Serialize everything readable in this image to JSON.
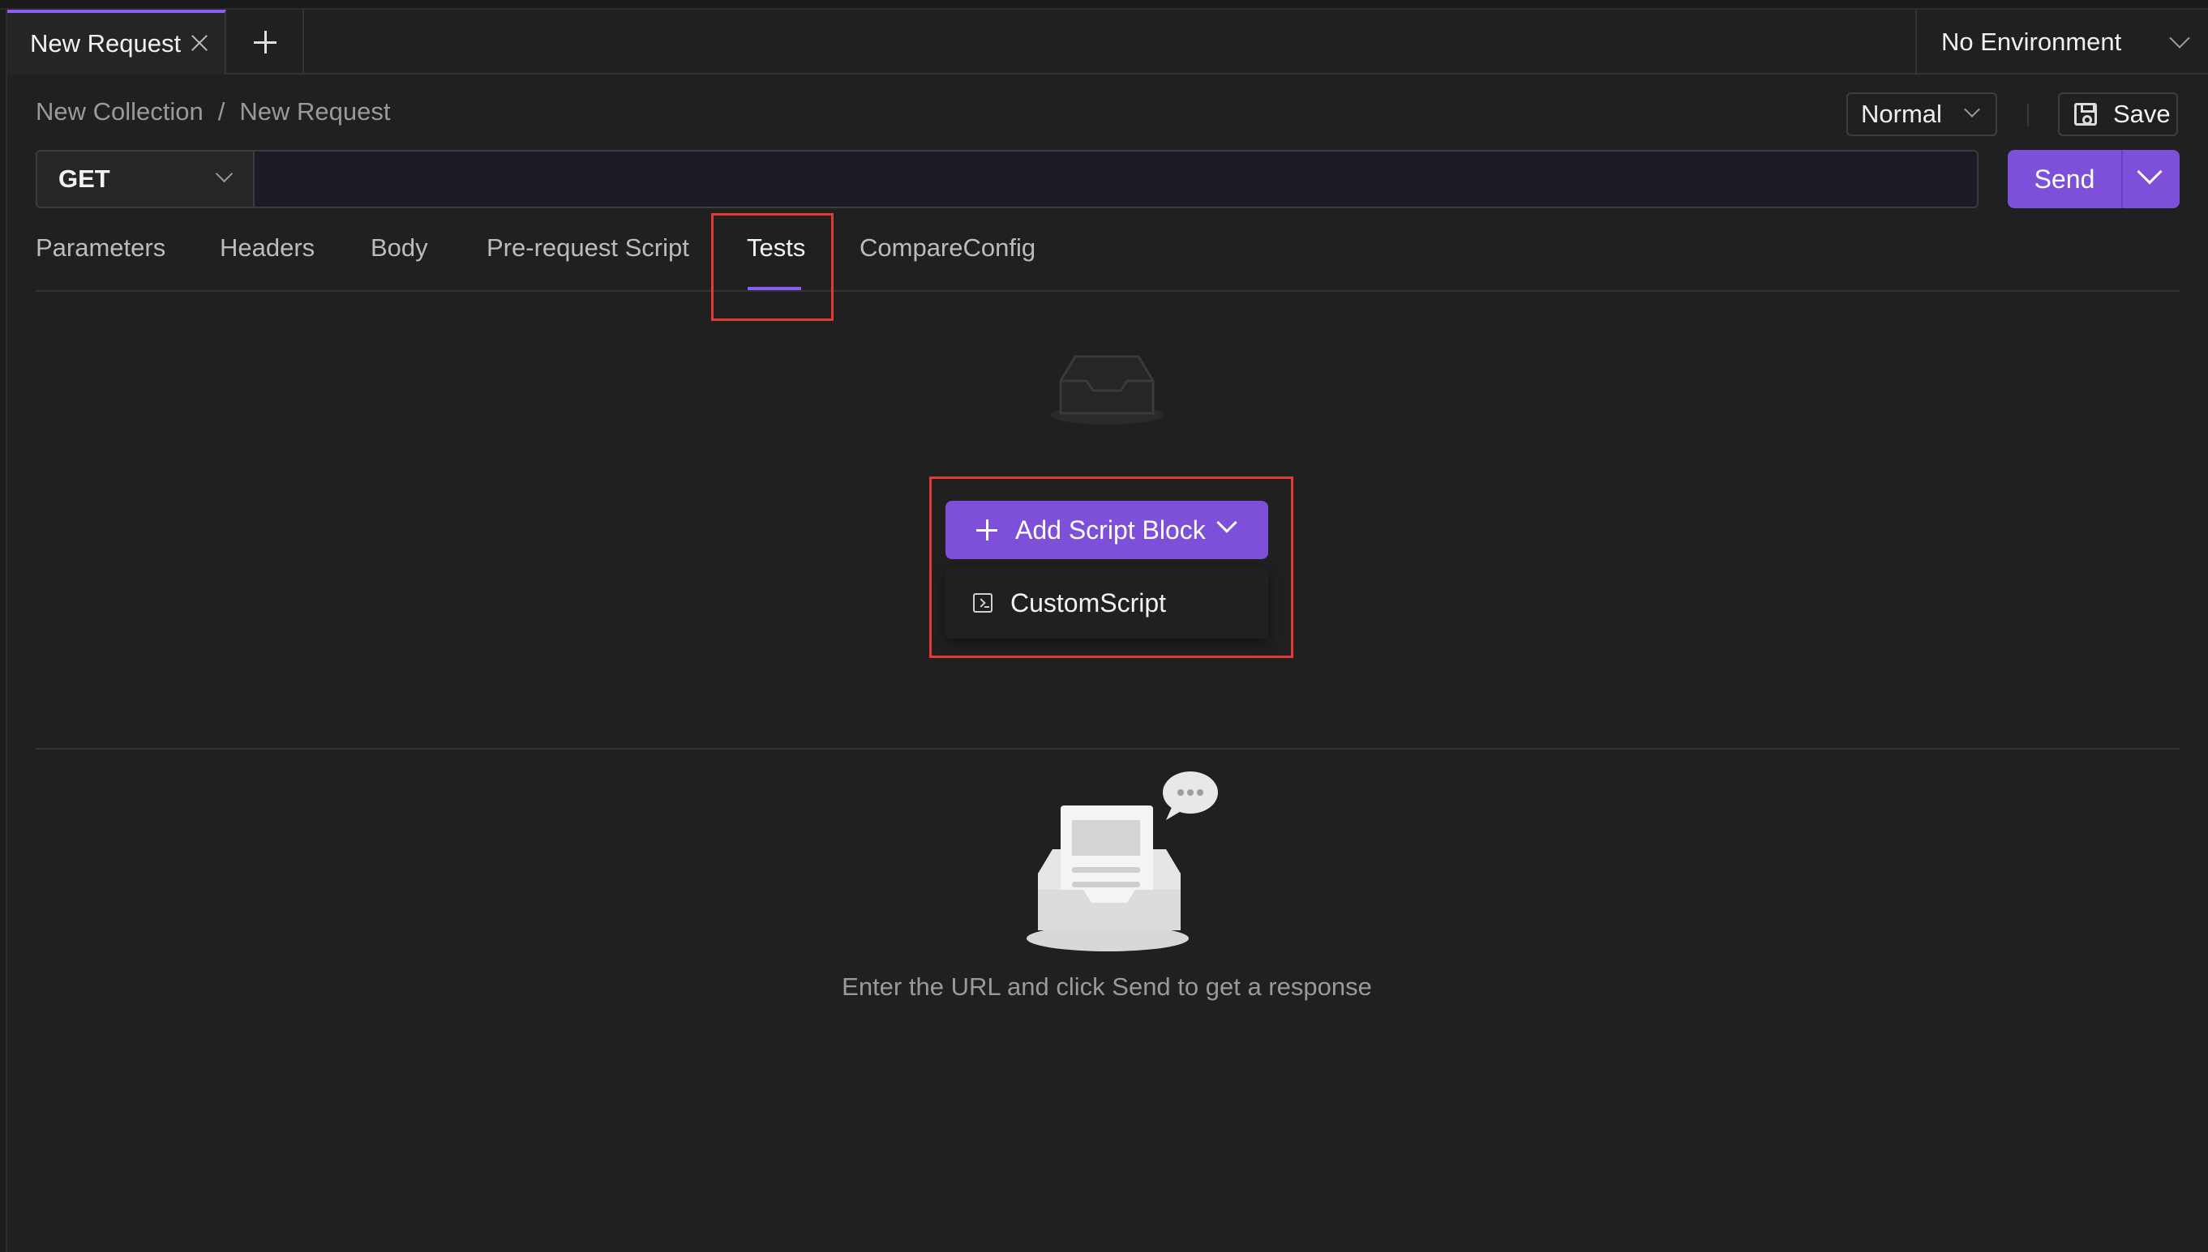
{
  "tabs": {
    "active_label": "New Request"
  },
  "environment": {
    "label": "No Environment"
  },
  "breadcrumb": {
    "collection": "New Collection",
    "separator": "/",
    "request": "New Request"
  },
  "mode": {
    "label": "Normal"
  },
  "toolbar": {
    "save_label": "Save"
  },
  "request": {
    "method": "GET",
    "url": "",
    "send_label": "Send"
  },
  "request_tabs": [
    {
      "label": "Parameters"
    },
    {
      "label": "Headers"
    },
    {
      "label": "Body"
    },
    {
      "label": "Pre-request Script"
    },
    {
      "label": "Tests",
      "active": true
    },
    {
      "label": "CompareConfig"
    }
  ],
  "tests": {
    "add_button_label": "Add Script Block",
    "dropdown_items": [
      {
        "label": "CustomScript",
        "icon": "terminal-icon"
      }
    ]
  },
  "response": {
    "empty_message": "Enter the URL and click Send to get a response"
  },
  "colors": {
    "accent": "#7e4fd8",
    "highlight": "#e53935",
    "background": "#202020"
  }
}
